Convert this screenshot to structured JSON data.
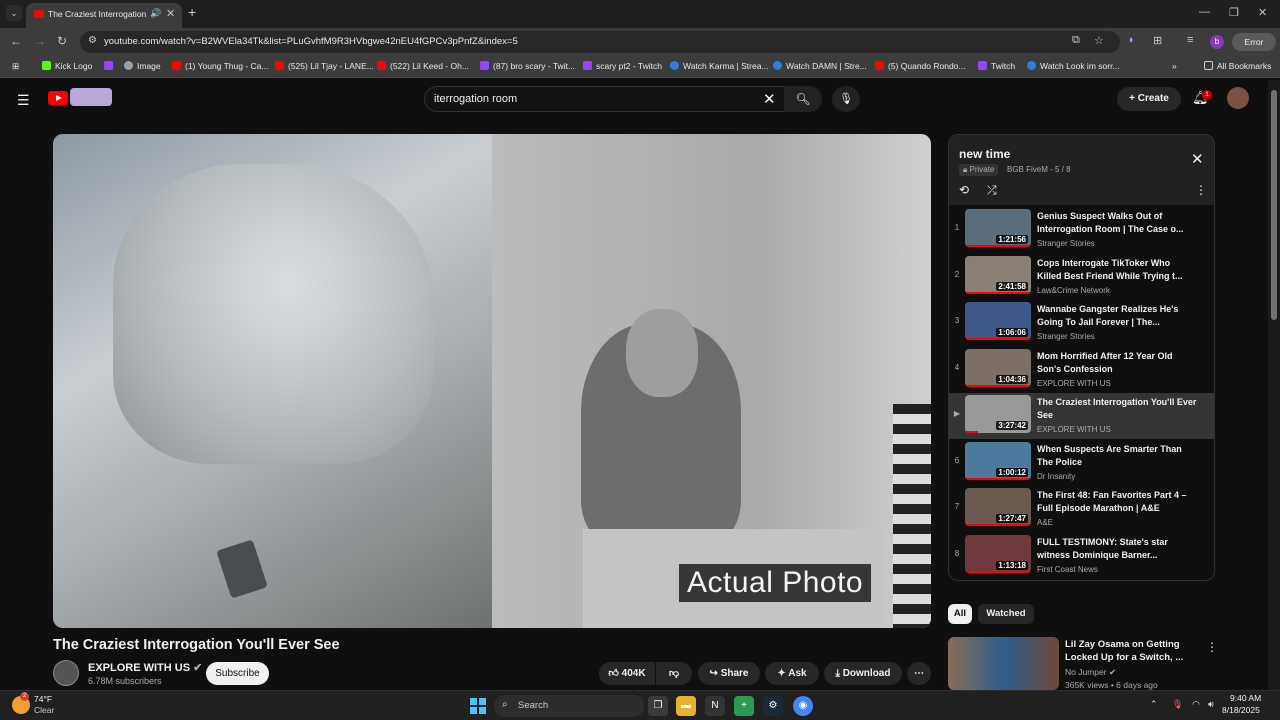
{
  "browser": {
    "tab_title": "The Craziest Interrogation You'll Ever See",
    "url": "youtube.com/watch?v=B2WVEla34Tk&list=PLuGvhfM9R3HVbgwe42nEU4fGPCv3pPnfZ&index=5",
    "profile_initial": "b",
    "error_label": "Error",
    "bookmarks": [
      {
        "label": "Kick Logo",
        "color": "#53fc18"
      },
      {
        "label": "Image",
        "color": "#9aa0a6"
      },
      {
        "label": "(1) Young Thug - Ca...",
        "color": "#ff0000"
      },
      {
        "label": "(525) Lil Tjay - LANE...",
        "color": "#ff0000"
      },
      {
        "label": "(522) Lil Keed - Oh...",
        "color": "#ff0000"
      },
      {
        "label": "(87) bro scary - Twit...",
        "color": "#9146ff"
      },
      {
        "label": "scary pt2 - Twitch",
        "color": "#9146ff"
      },
      {
        "label": "Watch Karma | Strea...",
        "color": "#2f7de1"
      },
      {
        "label": "Watch DAMN | Stre...",
        "color": "#2f7de1"
      },
      {
        "label": "(5) Quando Rondo...",
        "color": "#ff0000"
      },
      {
        "label": "Twitch",
        "color": "#9146ff"
      },
      {
        "label": "Watch Look im sorr...",
        "color": "#2f7de1"
      }
    ],
    "all_bookmarks": "All Bookmarks"
  },
  "youtube": {
    "search_query": "iterrogation room",
    "create_label": "Create",
    "notif_count": "1",
    "video": {
      "overlay_caption": "Actual Photo",
      "title": "The Craziest Interrogation You'll Ever See",
      "channel": "EXPLORE WITH US",
      "subscribers": "6.78M subscribers",
      "subscribe_label": "Subscribe",
      "likes": "404K",
      "share_label": "Share",
      "ask_label": "Ask",
      "download_label": "Download"
    },
    "playlist": {
      "title": "new time",
      "privacy": "Private",
      "meta": "BGB FiveM - 5 / 8",
      "items": [
        {
          "index": "1",
          "title": "Genius Suspect Walks Out of Interrogation Room | The Case o...",
          "channel": "Stranger Stories",
          "duration": "1:21:56",
          "thumb": "#5b6d7a",
          "progress": 100
        },
        {
          "index": "2",
          "title": "Cops Interrogate TikToker Who Killed Best Friend While Trying t...",
          "channel": "Law&Crime Network",
          "duration": "2:41:58",
          "thumb": "#8a7f74",
          "progress": 100
        },
        {
          "index": "3",
          "title": "Wannabe Gangster Realizes He's Going To Jail Forever | The...",
          "channel": "Stranger Stories",
          "duration": "1:06:06",
          "thumb": "#3d5a8a",
          "progress": 100
        },
        {
          "index": "4",
          "title": "Mom Horrified After 12 Year Old Son's Confession",
          "channel": "EXPLORE WITH US",
          "duration": "1:04:36",
          "thumb": "#7d6f66",
          "progress": 100
        },
        {
          "index": "▶",
          "title": "The Craziest Interrogation You'll Ever See",
          "channel": "EXPLORE WITH US",
          "duration": "3:27:42",
          "thumb": "#999999",
          "progress": 20
        },
        {
          "index": "6",
          "title": "When Suspects Are Smarter Than The Police",
          "channel": "Dr Insanity",
          "duration": "1:00:12",
          "thumb": "#4c7a9c",
          "progress": 100
        },
        {
          "index": "7",
          "title": "The First 48: Fan Favorites Part 4 – Full Episode Marathon | A&E",
          "channel": "A&E",
          "duration": "1:27:47",
          "thumb": "#6a5a50",
          "progress": 100
        },
        {
          "index": "8",
          "title": "FULL TESTIMONY: State's star witness Dominique Barner...",
          "channel": "First Coast News",
          "duration": "1:13:18",
          "thumb": "#6e3a3e",
          "progress": 100
        }
      ]
    },
    "chips": [
      "All",
      "Watched"
    ],
    "recommendation": {
      "title": "Lil Zay Osama on Getting Locked Up for a Switch, ...",
      "channel": "No Jumper",
      "meta": "365K views • 6 days ago"
    }
  },
  "taskbar": {
    "temperature": "74°F",
    "condition": "Clear",
    "weather_badge": "2",
    "search_label": "Search",
    "time": "9:40 AM",
    "date": "8/18/2025"
  }
}
